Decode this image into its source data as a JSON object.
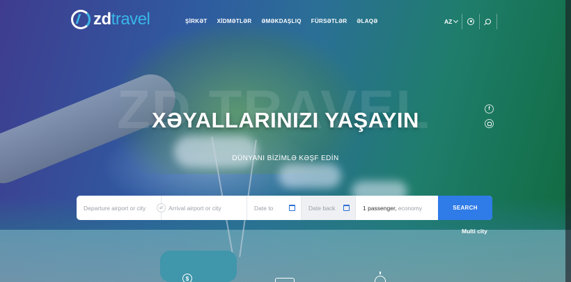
{
  "header": {
    "logo": {
      "zd": "zd",
      "travel": "travel"
    },
    "nav": [
      {
        "label": "ŞİRKƏT"
      },
      {
        "label": "XİDMƏTLƏR"
      },
      {
        "label": "ƏMƏKDAŞLIQ"
      },
      {
        "label": "FÜRSƏTLƏR"
      },
      {
        "label": "ƏLAQƏ"
      }
    ],
    "language": "AZ"
  },
  "hero": {
    "watermark": "ZD TRAVEL",
    "title": "XƏYALLARINIZI YAŞAYIN",
    "subtitle": "DÜNYANI BİZİMLƏ KƏŞF EDİN"
  },
  "social": {
    "facebook": "f"
  },
  "search": {
    "departure_placeholder": "Departure airport or city",
    "arrival_placeholder": "Arrival airport or city",
    "date_to_placeholder": "Date to",
    "date_back_placeholder": "Date back",
    "passengers_value": "1 passenger,",
    "class_value": "economy",
    "search_label": "SEARCH",
    "multi_city_label": "Multi city"
  },
  "icons": {
    "dollar": "$"
  },
  "colors": {
    "accent": "#2f7be8",
    "brand": "#39b6e8"
  }
}
